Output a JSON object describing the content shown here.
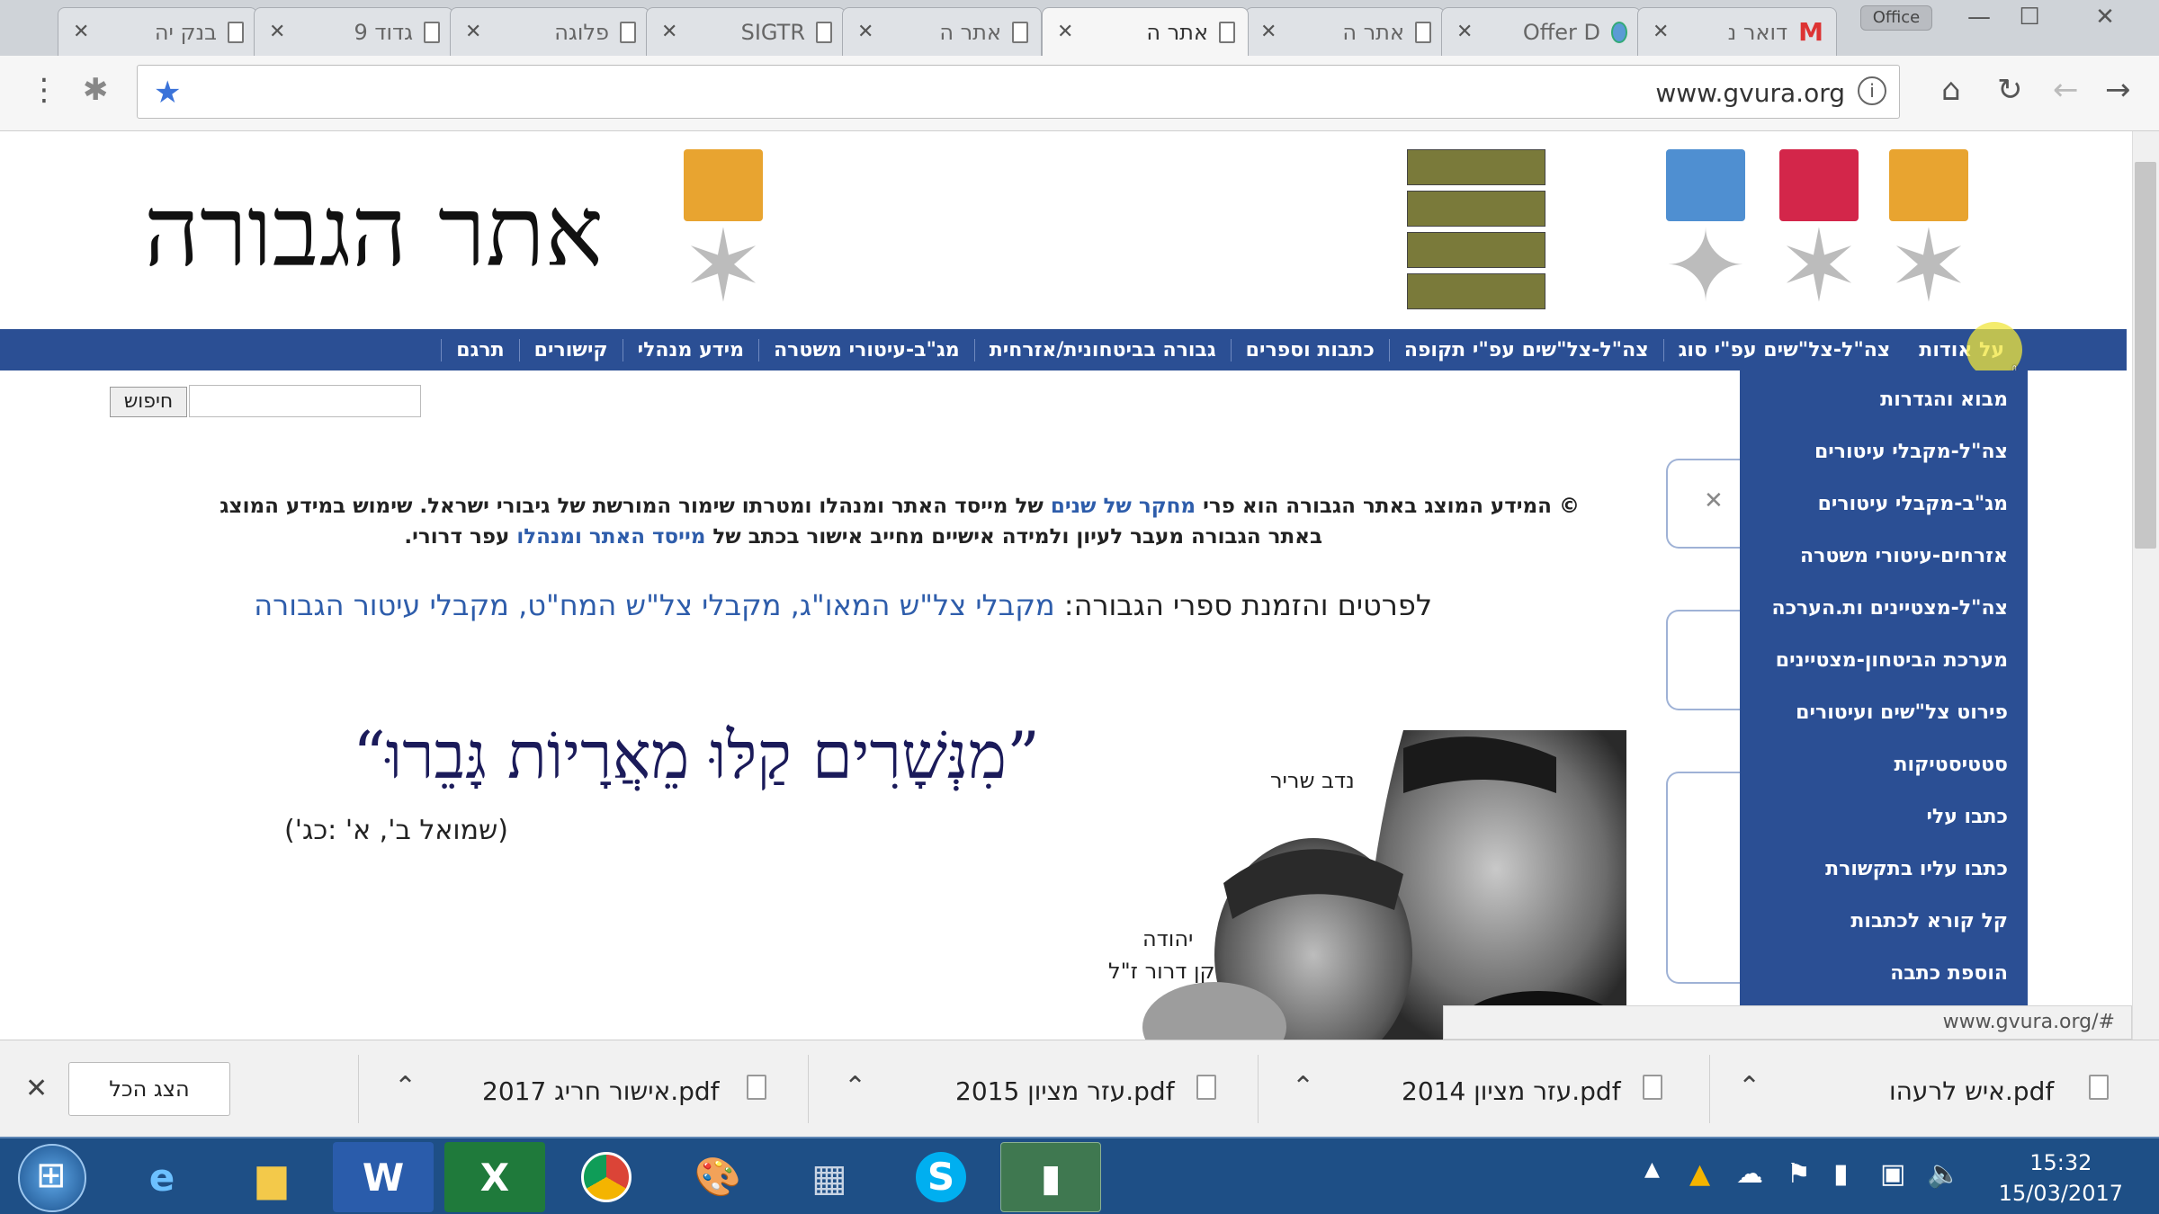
{
  "browser": {
    "tabs": [
      {
        "title": "בנק יה"
      },
      {
        "title": "גדוד 9"
      },
      {
        "title": "פלוגה"
      },
      {
        "title": "SIGTR"
      },
      {
        "title": "אתר ה"
      },
      {
        "title": "אתר ה",
        "active": true
      },
      {
        "title": "אתר ה"
      },
      {
        "title": "Offer D"
      },
      {
        "title": "דואר נ"
      }
    ],
    "profile_label": "Office",
    "url": "www.gvura.org"
  },
  "site": {
    "title": "אתר הגבורה",
    "nav": [
      "על אודות",
      "צה\"ל-צל\"שים עפ\"י סוג",
      "צה\"ל-צל\"שים עפ\"י תקופה",
      "כתבות וספרים",
      "גבורה בביטחונית/אזרחית",
      "מג\"ב-עיטורי משטרה",
      "מידע מנהלי",
      "קישורים",
      "תרגם"
    ],
    "dropdown": [
      "מבוא והגדרות",
      "צה\"ל-מקבלי עיטורים",
      "מג\"ב-מקבלי עיטורים",
      "אזרחים-עיטורי משטרה",
      "צה\"ל-מצטיינים ות.הערכה",
      "מערכת הביטחון-מצטיינים",
      "פירוט צל\"שים ועיטורים",
      "סטטיסטיקות",
      "כתבו עלי",
      "כתבו עליו בתקשורת",
      "קל קורא לכתבות",
      "הוספת כתבה"
    ],
    "search_button": "חיפוש",
    "copyright": {
      "line1_a": "© המידע המוצג באתר הגבורה הוא פרי",
      "line1_link": "מחקר של שנים",
      "line1_b": "של מייסד האתר ומנהלו ומטרתו שימור המורשת של גיבורי ישראל. שימוש במידע המוצג",
      "line2_a": "באתר הגבורה מעבר לעיון ולמידה אישיים מחייב אישור בכתב של",
      "line2_link": "מייסד האתר ומנהלו",
      "line2_b": "עפר דרורי."
    },
    "books": {
      "prefix": "לפרטים והזמנת ספרי הגבורה:",
      "link1": "מקבלי צל\"ש המאו\"ג,",
      "link2": "מקבלי צל\"ש המח\"ט,",
      "link3": "מקבלי עיטור הגבורה"
    },
    "quote": "”מִנְּשָׁרִים קַלּוּ מֵאֲרָיוֹת גָּבֵרוּ“",
    "quote_source": "(שמואל ב', א' :כג')",
    "captions": [
      "נדב שריר",
      "יהודה",
      "קן דרור ז\"ל"
    ]
  },
  "status_url": "www.gvura.org/#",
  "downloads": {
    "items": [
      "איש לרעהו.pdf",
      "עזר מציון 2014.pdf",
      "עזר מציון 2015.pdf",
      "אישור חריג 2017.pdf"
    ],
    "show_all": "הצג הכל"
  },
  "taskbar": {
    "time": "15:32",
    "date": "15/03/2017"
  },
  "colors": {
    "nav_blue": "#2b4f94",
    "link_blue": "#2e5dab",
    "taskbar": "#1e4f86"
  }
}
